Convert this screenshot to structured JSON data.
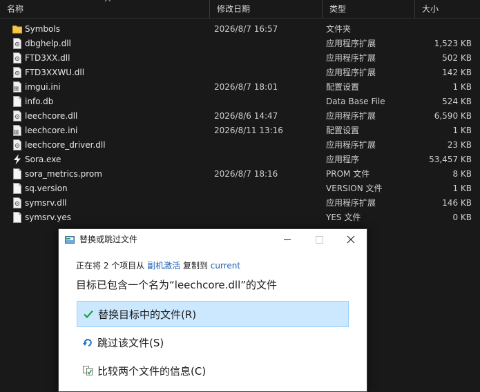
{
  "columns": {
    "name": "名称",
    "modified": "修改日期",
    "type": "类型",
    "size": "大小"
  },
  "files": [
    {
      "icon": "folder-icon",
      "name": "Symbols",
      "modified": "2026/8/7 16:57",
      "type": "文件夹",
      "size": ""
    },
    {
      "icon": "dll-file-icon",
      "name": "dbghelp.dll",
      "modified": "",
      "type": "应用程序扩展",
      "size": "1,523 KB"
    },
    {
      "icon": "dll-file-icon",
      "name": "FTD3XX.dll",
      "modified": "",
      "type": "应用程序扩展",
      "size": "502 KB"
    },
    {
      "icon": "dll-file-icon",
      "name": "FTD3XXWU.dll",
      "modified": "",
      "type": "应用程序扩展",
      "size": "142 KB"
    },
    {
      "icon": "settings-file-icon",
      "name": "imgui.ini",
      "modified": "2026/8/7 18:01",
      "type": "配置设置",
      "size": "1 KB"
    },
    {
      "icon": "file-icon",
      "name": "info.db",
      "modified": "",
      "type": "Data Base File",
      "size": "524 KB"
    },
    {
      "icon": "dll-file-icon",
      "name": "leechcore.dll",
      "modified": "2026/8/6 14:47",
      "type": "应用程序扩展",
      "size": "6,590 KB"
    },
    {
      "icon": "settings-file-icon",
      "name": "leechcore.ini",
      "modified": "2026/8/11 13:16",
      "type": "配置设置",
      "size": "1 KB"
    },
    {
      "icon": "dll-file-icon",
      "name": "leechcore_driver.dll",
      "modified": "",
      "type": "应用程序扩展",
      "size": "23 KB"
    },
    {
      "icon": "exe-icon",
      "name": "Sora.exe",
      "modified": "",
      "type": "应用程序",
      "size": "53,457 KB"
    },
    {
      "icon": "file-icon",
      "name": "sora_metrics.prom",
      "modified": "2026/8/7 18:16",
      "type": "PROM 文件",
      "size": "8 KB"
    },
    {
      "icon": "file-icon",
      "name": "sq.version",
      "modified": "",
      "type": "VERSION 文件",
      "size": "1 KB"
    },
    {
      "icon": "dll-file-icon",
      "name": "symsrv.dll",
      "modified": "",
      "type": "应用程序扩展",
      "size": "146 KB"
    },
    {
      "icon": "file-icon",
      "name": "symsrv.yes",
      "modified": "",
      "type": "YES 文件",
      "size": "0 KB"
    }
  ],
  "dialog": {
    "title": "替换或跳过文件",
    "info_prefix": "正在将 2 个项目从",
    "source": "副机激活",
    "info_middle": "复制到",
    "destination": "current",
    "message": "目标已包含一个名为“leechcore.dll”的文件",
    "options": {
      "replace": "替换目标中的文件(R)",
      "skip": "跳过该文件(S)",
      "compare": "比较两个文件的信息(C)"
    }
  },
  "colors": {
    "background": "#191919",
    "folder": "#f4c94a",
    "selection": "#cce8ff",
    "link": "#1a5fb4",
    "check": "#1e9e3c"
  }
}
